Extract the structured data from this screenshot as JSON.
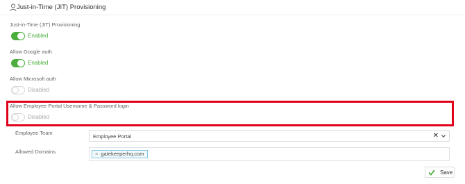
{
  "header": {
    "title": "Just-in-Time (JIT) Provisioning",
    "icon": "user-icon"
  },
  "settings": [
    {
      "label": "Just-in-Time (JIT) Provisioning",
      "state": "Enabled",
      "on": true
    },
    {
      "label": "Allow Google auth",
      "state": "Enabled",
      "on": true
    },
    {
      "label": "Allow Microsoft auth",
      "state": "Disabled",
      "on": false
    },
    {
      "label": "Allow Employee Portal Username & Password login",
      "state": "Disabled",
      "on": false
    }
  ],
  "employee_team": {
    "label": "Employee Team",
    "value": "Employee Portal"
  },
  "allowed_domains": {
    "label": "Allowed Domains",
    "tags": [
      "gatekeeperhq.com"
    ]
  },
  "save_button": {
    "label": "Save"
  },
  "colors": {
    "enabled": "#4cae3d",
    "highlight": "#e0001a"
  }
}
